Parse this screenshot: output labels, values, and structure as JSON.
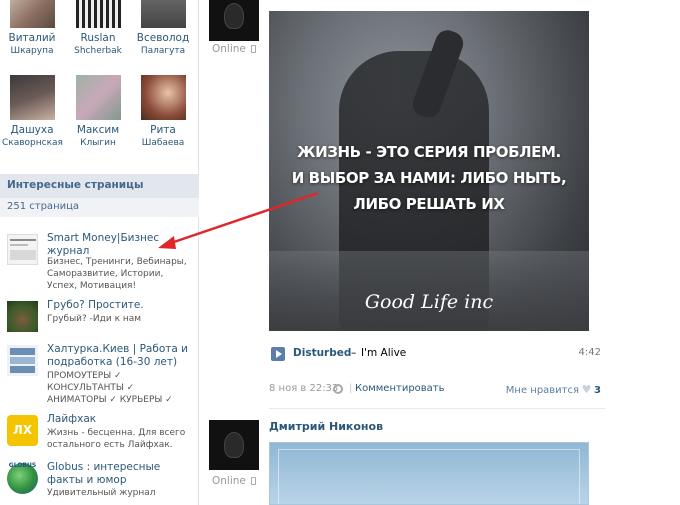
{
  "friends": [
    {
      "first": "Виталий",
      "last": "Шкарупа"
    },
    {
      "first": "Ruslan",
      "last": "Shcherbak"
    },
    {
      "first": "Всеволод",
      "last": "Палагута"
    },
    {
      "first": "Дашуха",
      "last": "Скаворнская"
    },
    {
      "first": "Максим",
      "last": "Клыгин"
    },
    {
      "first": "Рита",
      "last": "Шабаева"
    }
  ],
  "interesting_pages": {
    "title": "Интересные страницы",
    "count": "251 страница",
    "items": [
      {
        "title": "Smart Money|Бизнес журнал",
        "desc": "Бизнес, Тренинги, Вебинары, Саморазвитие, Истории, Успех, Мотивация!"
      },
      {
        "title": "Грубо? Простите.",
        "desc": "Грубый? -Иди к нам"
      },
      {
        "title": "Халтурка.Киев | Работа и подработка (16-30 лет)",
        "desc": "ПРОМОУТЕРЫ ✓ КОНСУЛЬТАНТЫ ✓ АНИМАТОРЫ ✓ КУРЬЕРЫ ✓"
      },
      {
        "title": "Лайфхак",
        "desc": "Жизнь - бесценна. Для всего остального есть Лайфхак."
      },
      {
        "title": "Globus : интересные факты и юмор",
        "desc": "Удивительный журнал"
      }
    ],
    "icon_texts": {
      "lifehack": "ЛХ",
      "globus": "GLOBUS"
    }
  },
  "post1": {
    "online": "Online",
    "quote_lines": [
      "ЖИЗНЬ - ЭТО СЕРИЯ ПРОБЛЕМ.",
      "И ВЫБОР ЗА НАМИ: ЛИБО НЫТЬ,",
      "ЛИБО РЕШАТЬ ИХ"
    ],
    "signature": "Good Life inc",
    "audio": {
      "artist": "Disturbed",
      "dash": "–",
      "title": "I'm Alive",
      "duration": "4:42"
    },
    "date": "8 ноя в 22:33",
    "separator": "|",
    "comment": "Комментировать",
    "like_label": "Мне нравится",
    "like_count": "3"
  },
  "post2": {
    "author": "Дмитрий Никонов",
    "online": "Online"
  },
  "colors": {
    "link": "#2b587a",
    "accent": "#45688e",
    "arrow": "#e0252b"
  }
}
